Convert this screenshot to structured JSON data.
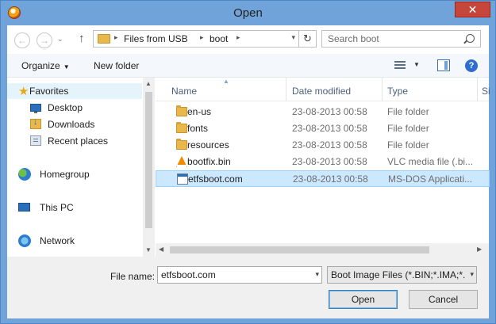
{
  "window": {
    "title": "Open",
    "close_glyph": "✕"
  },
  "navbar": {
    "back_glyph": "←",
    "forward_glyph": "→",
    "history_glyph": "⌄",
    "up_glyph": "↑",
    "breadcrumb": [
      "Files from USB",
      "boot"
    ],
    "refresh_glyph": "↻",
    "search_placeholder": "Search boot"
  },
  "commandbar": {
    "organize_label": "Organize",
    "new_folder_label": "New folder",
    "help_glyph": "?"
  },
  "navpane": {
    "favorites_label": "Favorites",
    "favorites": [
      "Desktop",
      "Downloads",
      "Recent places"
    ],
    "homegroup_label": "Homegroup",
    "this_pc_label": "This PC",
    "network_label": "Network"
  },
  "filelist": {
    "columns": [
      "Name",
      "Date modified",
      "Type",
      "Si"
    ],
    "rows": [
      {
        "name": "en-us",
        "date": "23-08-2013 00:58",
        "type": "File folder",
        "icon": "folder-icon"
      },
      {
        "name": "fonts",
        "date": "23-08-2013 00:58",
        "type": "File folder",
        "icon": "folder-icon"
      },
      {
        "name": "resources",
        "date": "23-08-2013 00:58",
        "type": "File folder",
        "icon": "folder-icon"
      },
      {
        "name": "bootfix.bin",
        "date": "23-08-2013 00:58",
        "type": "VLC media file (.bi...",
        "icon": "vlc-icon"
      },
      {
        "name": "etfsboot.com",
        "date": "23-08-2013 00:58",
        "type": "MS-DOS Applicati...",
        "icon": "application-icon",
        "selected": true
      }
    ]
  },
  "bottom": {
    "file_name_label": "File name:",
    "file_name_value": "etfsboot.com",
    "filter_value": "Boot Image Files (*.BIN;*.IMA;*.",
    "open_label": "Open",
    "cancel_label": "Cancel"
  },
  "colors": {
    "frame": "#6fa3d9",
    "close": "#c7463b",
    "selection": "#cce8ff",
    "folder": "#e8b84a"
  }
}
